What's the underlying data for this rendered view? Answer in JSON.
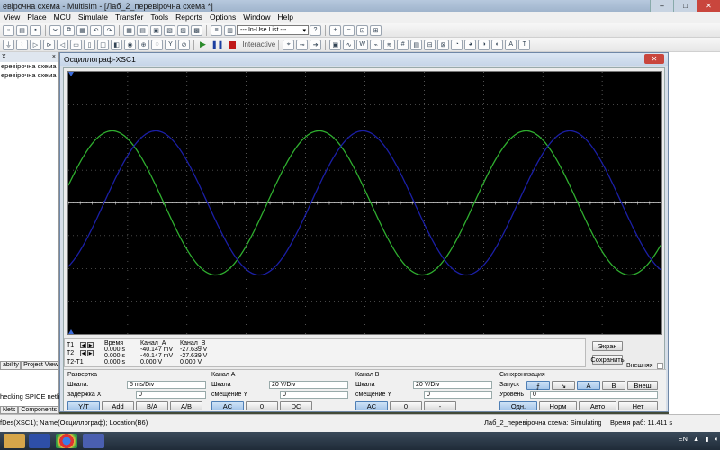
{
  "app": {
    "title": "евірочна схема - Multisim - [Лаб_2_перевірочна схема *]",
    "min": "–",
    "max": "□",
    "close": "✕"
  },
  "menu": [
    "View",
    "Place",
    "MCU",
    "Simulate",
    "Transfer",
    "Tools",
    "Reports",
    "Options",
    "Window",
    "Help"
  ],
  "toolbar": {
    "in_use_list": "--- In-Use List ---",
    "interactive": "Interactive"
  },
  "left_panel": {
    "header": "X",
    "tree": [
      "еревірочна схема",
      "еревірочна схема"
    ],
    "tabs": [
      "ability",
      "Project View"
    ],
    "tabs2": [
      "Nets",
      "Components"
    ],
    "status_line": "hecking SPICE netlist fo"
  },
  "osc": {
    "title": "Осциллограф-XSC1",
    "close": "✕",
    "readout": {
      "rows": [
        "T1",
        "T2",
        "T2-T1"
      ],
      "col_time_head": "Время",
      "col_a_head": "Канал_A",
      "col_b_head": "Канал_B",
      "time": [
        "0.000 s",
        "0.000 s",
        "0.000 s"
      ],
      "chan_a": [
        "-40.147 mV",
        "-40.147 mV",
        "0.000 V"
      ],
      "chan_b": [
        "-27.639 V",
        "-27.639 V",
        "0.000 V"
      ]
    },
    "buttons": {
      "screen": "Экран",
      "save": "Сохранить",
      "external": "Внешняя"
    },
    "timebase": {
      "title": "Развертка",
      "scale_label": "Шкала:",
      "scale_value": "5 ms/Div",
      "xpos_label": "задержка X",
      "xpos_value": "0",
      "modes": [
        "Y/T",
        "Add",
        "B/A",
        "A/B"
      ]
    },
    "channel_a": {
      "title": "Канал А",
      "scale_label": "Шкала",
      "scale_value": "20  V/Div",
      "ypos_label": "смещение Y",
      "ypos_value": "0",
      "coupling": [
        "AC",
        "0",
        "DC"
      ]
    },
    "channel_b": {
      "title": "Канал В",
      "scale_label": "Шкала",
      "scale_value": "20  V/Div",
      "ypos_label": "смещение Y",
      "ypos_value": "0",
      "coupling": [
        "AC",
        "0",
        "-"
      ]
    },
    "trigger": {
      "title": "Синхронизация",
      "edge_label": "Запуск",
      "edges": [
        "⨍",
        "↘",
        "A",
        "B",
        "Внеш"
      ],
      "level_label": "Уровень",
      "level_value": "0",
      "modes": [
        "Одн.",
        "Норм",
        "Авто",
        "Нет"
      ]
    },
    "colors": {
      "trace_a": "#2fae2f",
      "trace_b": "#1b1fa6",
      "grid": "#8a8a8a"
    }
  },
  "statusbar": {
    "left": "fDes(XSC1); Name(Осциллограф); Location(B6)",
    "middle": "Лаб_2_перевірочна схема: Simulating...",
    "right": "Время раб: 11.411 s"
  },
  "tray": {
    "lang": "EN"
  }
}
